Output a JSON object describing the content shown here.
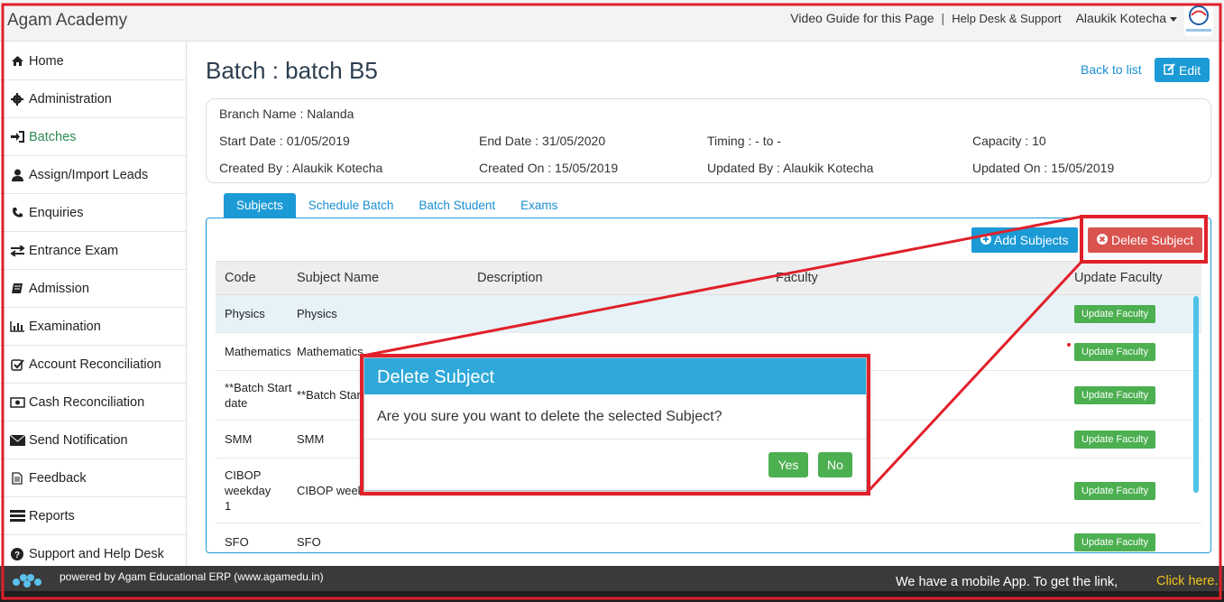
{
  "topbar": {
    "brand": "Agam Academy",
    "video_guide": "Video Guide for this Page",
    "separator": "|",
    "help_desk": "Help Desk & Support",
    "user": "Alaukik Kotecha"
  },
  "sidebar": {
    "items": [
      {
        "label": "Home",
        "icon": "home-icon"
      },
      {
        "label": "Administration",
        "icon": "gear-icon"
      },
      {
        "label": "Batches",
        "icon": "sign-in-icon"
      },
      {
        "label": "Assign/Import Leads",
        "icon": "user-icon"
      },
      {
        "label": "Enquiries",
        "icon": "phone-icon"
      },
      {
        "label": "Entrance Exam",
        "icon": "exchange-icon"
      },
      {
        "label": "Admission",
        "icon": "book-icon"
      },
      {
        "label": "Examination",
        "icon": "bar-chart-icon"
      },
      {
        "label": "Account Reconciliation",
        "icon": "check-square-icon"
      },
      {
        "label": "Cash Reconciliation",
        "icon": "money-icon"
      },
      {
        "label": "Send Notification",
        "icon": "envelope-icon"
      },
      {
        "label": "Feedback",
        "icon": "file-icon"
      },
      {
        "label": "Reports",
        "icon": "list-icon"
      },
      {
        "label": "Support and Help Desk",
        "icon": "question-circle-icon"
      }
    ]
  },
  "page": {
    "title": "Batch : batch B5",
    "back_link": "Back to list",
    "edit_label": "Edit"
  },
  "info": {
    "branch": "Branch Name : Nalanda",
    "start_date": "Start Date : 01/05/2019",
    "end_date": "End Date : 31/05/2020",
    "timing": "Timing : - to -",
    "capacity": "Capacity : 10",
    "created_by": "Created By : Alaukik Kotecha",
    "created_on": "Created On : 15/05/2019",
    "updated_by": "Updated By : Alaukik Kotecha",
    "updated_on": "Updated On : 15/05/2019"
  },
  "tabs": [
    "Subjects",
    "Schedule Batch",
    "Batch Student",
    "Exams"
  ],
  "actions": {
    "add_subjects": "Add Subjects",
    "delete_subject": "Delete Subject"
  },
  "table": {
    "headers": [
      "Code",
      "Subject Name",
      "Description",
      "Faculty",
      "Update Faculty"
    ],
    "button_label": "Update Faculty",
    "rows": [
      {
        "code": "Physics",
        "name": "Physics"
      },
      {
        "code": "Mathematics",
        "name": "Mathematics"
      },
      {
        "code": "**Batch Start date",
        "name": "**Batch Star"
      },
      {
        "code": "SMM",
        "name": "SMM"
      },
      {
        "code": "CIBOP weekday 1",
        "name": "CIBOP week"
      },
      {
        "code": "SFO",
        "name": "SFO"
      }
    ]
  },
  "modal": {
    "title": "Delete Subject",
    "message": "Are you sure you want to delete the selected Subject?",
    "yes": "Yes",
    "no": "No"
  },
  "footer": {
    "powered": "powered by Agam Educational ERP (www.agamedu.in)",
    "app_message": "We have a mobile App. To get the link,",
    "app_link": "Click here."
  },
  "colors": {
    "accent": "#1b9ad6",
    "danger": "#d9534f",
    "success": "#4caf50",
    "annotation": "#e0202a"
  }
}
